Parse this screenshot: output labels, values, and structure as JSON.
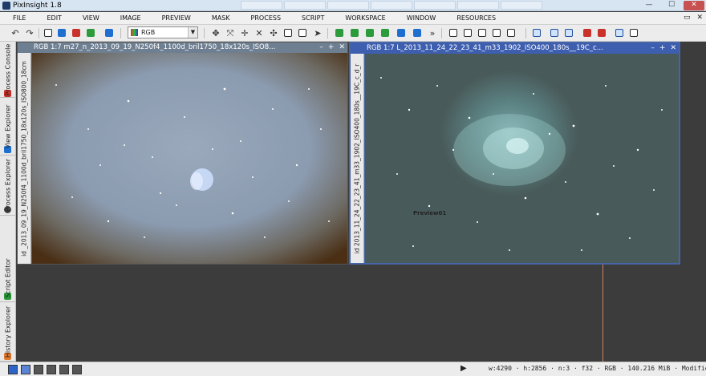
{
  "window": {
    "title": "PixInsight 1.8",
    "min": "—",
    "max": "☐",
    "close": "✕"
  },
  "menu": [
    "FILE",
    "EDIT",
    "VIEW",
    "IMAGE",
    "PREVIEW",
    "MASK",
    "PROCESS",
    "SCRIPT",
    "WORKSPACE",
    "WINDOW",
    "RESOURCES"
  ],
  "mdi": {
    "restore": "▭",
    "close": "✕"
  },
  "toolbar": {
    "channel_select": "RGB",
    "more": "»"
  },
  "left_dock": {
    "tabs": [
      "Process Console",
      "View Explorer",
      "Process Explorer",
      "Script Editor",
      "History Explorer"
    ]
  },
  "images": [
    {
      "caption": "RGB 1:7 m27_n_2013_09_19_N250f4_1100d_bril1750_18x120s_ISO8...",
      "side_label": "id _2013_09_19_N250f4_1100d_bril1750_18x120s_ISO800_18cm",
      "controls": [
        "–",
        "+",
        "✕"
      ]
    },
    {
      "caption": "RGB 1:7 L_2013_11_24_22_23_41_m33_1902_ISO400_180s__19C_c...",
      "side_label": "id 2013_11_24_22_23_41_m33_1902_ISO400_180s__19C_c_d_r",
      "controls": [
        "–",
        "+",
        "✕"
      ],
      "preview_label": "Preview01"
    }
  ],
  "status": {
    "play": "▶",
    "info": "w:4290  ·  h:2856  ·  n:3  ·  f32  ·  RGB  ·  140.216 MiB  ·  Modified"
  }
}
